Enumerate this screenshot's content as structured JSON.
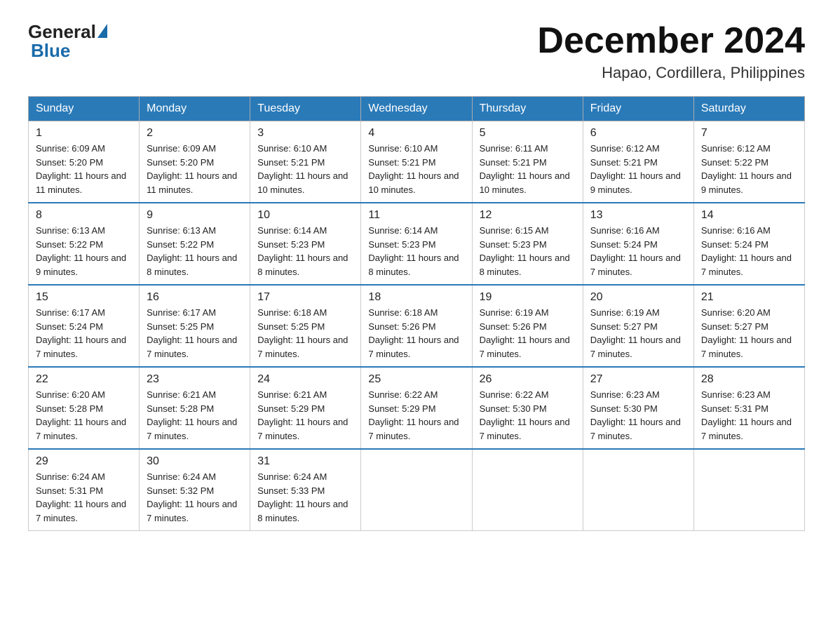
{
  "header": {
    "logo_general": "General",
    "logo_blue": "Blue",
    "month_title": "December 2024",
    "location": "Hapao, Cordillera, Philippines"
  },
  "days_of_week": [
    "Sunday",
    "Monday",
    "Tuesday",
    "Wednesday",
    "Thursday",
    "Friday",
    "Saturday"
  ],
  "weeks": [
    [
      {
        "day": "1",
        "sunrise": "6:09 AM",
        "sunset": "5:20 PM",
        "daylight": "11 hours and 11 minutes."
      },
      {
        "day": "2",
        "sunrise": "6:09 AM",
        "sunset": "5:20 PM",
        "daylight": "11 hours and 11 minutes."
      },
      {
        "day": "3",
        "sunrise": "6:10 AM",
        "sunset": "5:21 PM",
        "daylight": "11 hours and 10 minutes."
      },
      {
        "day": "4",
        "sunrise": "6:10 AM",
        "sunset": "5:21 PM",
        "daylight": "11 hours and 10 minutes."
      },
      {
        "day": "5",
        "sunrise": "6:11 AM",
        "sunset": "5:21 PM",
        "daylight": "11 hours and 10 minutes."
      },
      {
        "day": "6",
        "sunrise": "6:12 AM",
        "sunset": "5:21 PM",
        "daylight": "11 hours and 9 minutes."
      },
      {
        "day": "7",
        "sunrise": "6:12 AM",
        "sunset": "5:22 PM",
        "daylight": "11 hours and 9 minutes."
      }
    ],
    [
      {
        "day": "8",
        "sunrise": "6:13 AM",
        "sunset": "5:22 PM",
        "daylight": "11 hours and 9 minutes."
      },
      {
        "day": "9",
        "sunrise": "6:13 AM",
        "sunset": "5:22 PM",
        "daylight": "11 hours and 8 minutes."
      },
      {
        "day": "10",
        "sunrise": "6:14 AM",
        "sunset": "5:23 PM",
        "daylight": "11 hours and 8 minutes."
      },
      {
        "day": "11",
        "sunrise": "6:14 AM",
        "sunset": "5:23 PM",
        "daylight": "11 hours and 8 minutes."
      },
      {
        "day": "12",
        "sunrise": "6:15 AM",
        "sunset": "5:23 PM",
        "daylight": "11 hours and 8 minutes."
      },
      {
        "day": "13",
        "sunrise": "6:16 AM",
        "sunset": "5:24 PM",
        "daylight": "11 hours and 7 minutes."
      },
      {
        "day": "14",
        "sunrise": "6:16 AM",
        "sunset": "5:24 PM",
        "daylight": "11 hours and 7 minutes."
      }
    ],
    [
      {
        "day": "15",
        "sunrise": "6:17 AM",
        "sunset": "5:24 PM",
        "daylight": "11 hours and 7 minutes."
      },
      {
        "day": "16",
        "sunrise": "6:17 AM",
        "sunset": "5:25 PM",
        "daylight": "11 hours and 7 minutes."
      },
      {
        "day": "17",
        "sunrise": "6:18 AM",
        "sunset": "5:25 PM",
        "daylight": "11 hours and 7 minutes."
      },
      {
        "day": "18",
        "sunrise": "6:18 AM",
        "sunset": "5:26 PM",
        "daylight": "11 hours and 7 minutes."
      },
      {
        "day": "19",
        "sunrise": "6:19 AM",
        "sunset": "5:26 PM",
        "daylight": "11 hours and 7 minutes."
      },
      {
        "day": "20",
        "sunrise": "6:19 AM",
        "sunset": "5:27 PM",
        "daylight": "11 hours and 7 minutes."
      },
      {
        "day": "21",
        "sunrise": "6:20 AM",
        "sunset": "5:27 PM",
        "daylight": "11 hours and 7 minutes."
      }
    ],
    [
      {
        "day": "22",
        "sunrise": "6:20 AM",
        "sunset": "5:28 PM",
        "daylight": "11 hours and 7 minutes."
      },
      {
        "day": "23",
        "sunrise": "6:21 AM",
        "sunset": "5:28 PM",
        "daylight": "11 hours and 7 minutes."
      },
      {
        "day": "24",
        "sunrise": "6:21 AM",
        "sunset": "5:29 PM",
        "daylight": "11 hours and 7 minutes."
      },
      {
        "day": "25",
        "sunrise": "6:22 AM",
        "sunset": "5:29 PM",
        "daylight": "11 hours and 7 minutes."
      },
      {
        "day": "26",
        "sunrise": "6:22 AM",
        "sunset": "5:30 PM",
        "daylight": "11 hours and 7 minutes."
      },
      {
        "day": "27",
        "sunrise": "6:23 AM",
        "sunset": "5:30 PM",
        "daylight": "11 hours and 7 minutes."
      },
      {
        "day": "28",
        "sunrise": "6:23 AM",
        "sunset": "5:31 PM",
        "daylight": "11 hours and 7 minutes."
      }
    ],
    [
      {
        "day": "29",
        "sunrise": "6:24 AM",
        "sunset": "5:31 PM",
        "daylight": "11 hours and 7 minutes."
      },
      {
        "day": "30",
        "sunrise": "6:24 AM",
        "sunset": "5:32 PM",
        "daylight": "11 hours and 7 minutes."
      },
      {
        "day": "31",
        "sunrise": "6:24 AM",
        "sunset": "5:33 PM",
        "daylight": "11 hours and 8 minutes."
      },
      null,
      null,
      null,
      null
    ]
  ]
}
